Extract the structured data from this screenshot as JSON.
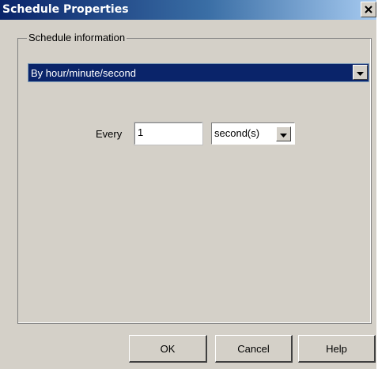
{
  "window": {
    "title": "Schedule Properties",
    "close_icon": "close-icon"
  },
  "group": {
    "legend": "Schedule information"
  },
  "schedule_type": {
    "selected": "By hour/minute/second",
    "icon": "chevron-down-icon"
  },
  "interval": {
    "label": "Every",
    "value": "1",
    "unit_selected": "second(s)"
  },
  "buttons": {
    "ok": "OK",
    "cancel": "Cancel",
    "help": "Help"
  },
  "colors": {
    "dialog_bg": "#d4d0c8",
    "title_bar_start": "#0a246a",
    "title_bar_end": "#a6caf0",
    "selection_bg": "#0a246a"
  }
}
